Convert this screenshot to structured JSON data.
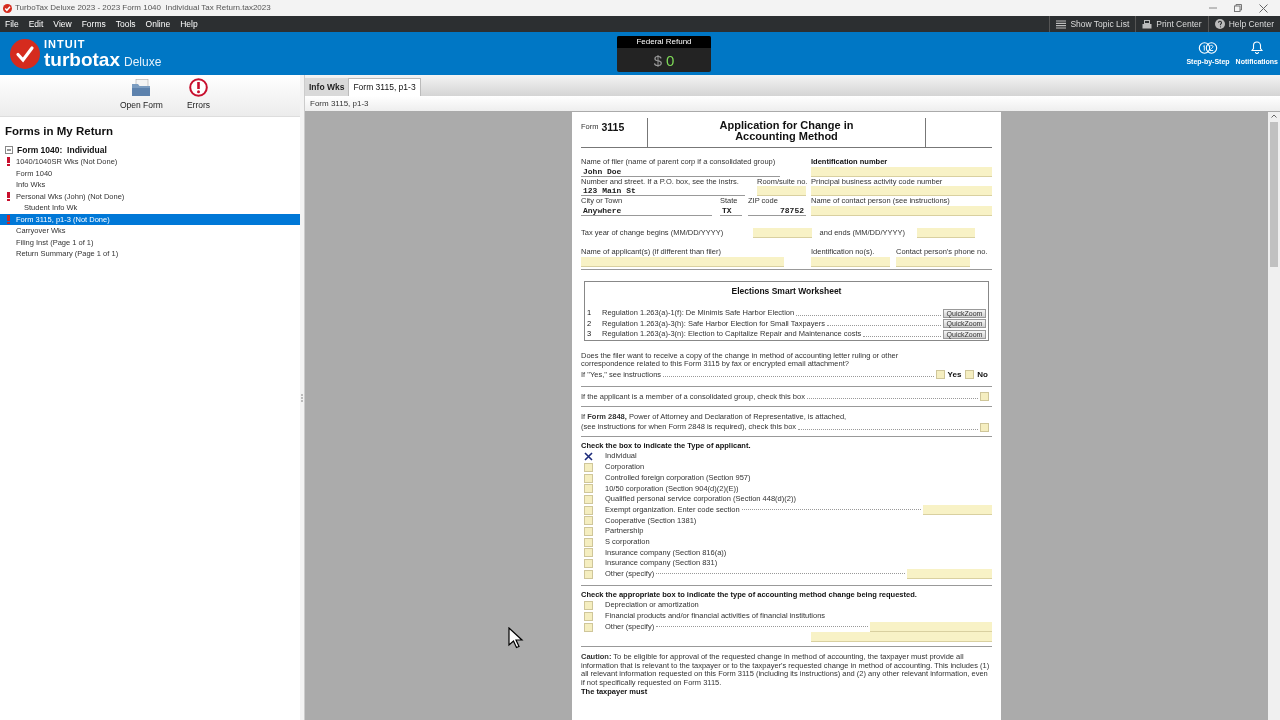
{
  "window": {
    "title": "TurboTax Deluxe 2023 - 2023 Form 1040  Individual Tax Return.tax2023"
  },
  "menu": [
    "File",
    "Edit",
    "View",
    "Forms",
    "Tools",
    "Online",
    "Help"
  ],
  "menu_links": [
    {
      "label": "Show Topic List",
      "kind": "list"
    },
    {
      "label": "Print Center",
      "kind": "printer"
    },
    {
      "label": "Help Center",
      "kind": "help"
    }
  ],
  "brand": {
    "company": "INTUIT",
    "product": "turbotax",
    "edition": "Deluxe"
  },
  "refund": {
    "label": "Federal Refund",
    "currency": "$",
    "amount": "0"
  },
  "header_buttons": [
    {
      "label": "Step-by-Step",
      "kind": "steps"
    },
    {
      "label": "Notifications",
      "kind": "bell"
    }
  ],
  "toolbar": [
    {
      "label": "Open Form",
      "kind": "folder"
    },
    {
      "label": "Errors",
      "kind": "error"
    }
  ],
  "forms_panel": {
    "title": "Forms in My Return",
    "tree": [
      {
        "label": "Form 1040:  Individual",
        "expanded": true,
        "children": [
          {
            "label": "1040/1040SR Wks (Not Done)",
            "error": true,
            "selected": false
          },
          {
            "label": "Form 1040",
            "error": false,
            "selected": false
          },
          {
            "label": "Info Wks",
            "error": false,
            "selected": false
          },
          {
            "label": "Personal Wks (John) (Not Done)",
            "error": true,
            "selected": false,
            "children": [
              {
                "label": "Student Info Wk",
                "error": false,
                "selected": false
              }
            ]
          },
          {
            "label": "Form 3115, p1-3 (Not Done)",
            "error": true,
            "selected": true
          },
          {
            "label": "Carryover Wks",
            "error": false,
            "selected": false
          },
          {
            "label": "Filing Inst (Page 1 of 1)",
            "error": false,
            "selected": false
          },
          {
            "label": "Return Summary (Page 1 of 1)",
            "error": false,
            "selected": false
          }
        ]
      }
    ]
  },
  "tabs": [
    {
      "label": "Info Wks",
      "selected": false
    },
    {
      "label": "Form 3115, p1-3",
      "selected": true
    }
  ],
  "breadcrumb": "Form 3115, p1-3",
  "form": {
    "prefix": "Form",
    "number": "3115",
    "title": "Application for Change in Accounting Method",
    "filer": {
      "label": "Name of filer (name of parent corp if a consolidated group)",
      "value": "John Doe"
    },
    "id_number": {
      "label": "Identification number"
    },
    "street": {
      "label": "Number and street. If a P.O. box, see the instrs.",
      "value": "123 Main St"
    },
    "room": {
      "label": "Room/suite no."
    },
    "activity_code": {
      "label": "Principal business activity code number"
    },
    "city": {
      "label": "City or Town",
      "value": "Anywhere"
    },
    "state": {
      "label": "State",
      "value": "TX"
    },
    "zip": {
      "label": "ZIP code",
      "value": "78752"
    },
    "contact": {
      "label": "Name of contact person (see instructions)"
    },
    "year_begins": {
      "label": "Tax year of change begins (MM/DD/YYYY)"
    },
    "year_ends": {
      "label": "and ends (MM/DD/YYYY)"
    },
    "applicant": {
      "label": "Name of applicant(s) (if different than filer)"
    },
    "id_nos": {
      "label": "Identification no(s)."
    },
    "phone": {
      "label": "Contact person's phone no."
    },
    "worksheet": {
      "title": "Elections Smart Worksheet",
      "lines": [
        {
          "number": "1",
          "text": "Regulation 1.263(a)-1(f): De Minimis Safe Harbor Election",
          "button": "QuickZoom"
        },
        {
          "number": "2",
          "text": "Regulation 1.263(a)-3(h): Safe Harbor Election for Small Taxpayers",
          "button": "QuickZoom"
        },
        {
          "number": "3",
          "text": "Regulation 1.263(a)-3(n): Election to Capitalize Repair and Maintenance costs",
          "button": "QuickZoom"
        }
      ]
    },
    "copy_question": {
      "text": "Does the filer want to receive a copy of the change in method of accounting letter ruling or other correspondence related to this Form 3115 by fax or encrypted email attachment?",
      "hint": "If \"Yes,\" see instructions",
      "options": [
        {
          "label": "Yes",
          "checked": false
        },
        {
          "label": "No",
          "checked": false
        }
      ]
    },
    "consolidated": {
      "text": "If the applicant is a member of a consolidated group, check this box",
      "checked": false
    },
    "form2848": {
      "text": "If **Form 2848,** Power of Attorney and Declaration of Representative, is attached,",
      "hint": "(see instructions for when Form 2848 is required), check this box",
      "checked": false
    },
    "applicant_type": {
      "heading": "Check the box to indicate the Type of applicant.",
      "options": [
        {
          "label": "Individual",
          "checked": true,
          "kind": "plain"
        },
        {
          "label": "Corporation",
          "checked": false,
          "kind": "plain"
        },
        {
          "label": "Controlled foreign corporation (Section 957)",
          "checked": false,
          "kind": "plain"
        },
        {
          "label": "10/50 corporation (Section 904(d)(2)(E))",
          "checked": false,
          "kind": "plain"
        },
        {
          "label": "Qualified personal service corporation (Section 448(d)(2))",
          "checked": false,
          "kind": "plain"
        },
        {
          "label": "Exempt organization. Enter code section",
          "checked": false,
          "kind": "field"
        },
        {
          "label": "Cooperative (Section 1381)",
          "checked": false,
          "kind": "plain"
        },
        {
          "label": "Partnership",
          "checked": false,
          "kind": "plain"
        },
        {
          "label": "S corporation",
          "checked": false,
          "kind": "plain"
        },
        {
          "label": "Insurance company (Section 816(a))",
          "checked": false,
          "kind": "plain"
        },
        {
          "label": "Insurance company (Section 831)",
          "checked": false,
          "kind": "plain"
        },
        {
          "label": "Other (specify)",
          "checked": false,
          "kind": "wide_field"
        }
      ]
    },
    "change_type": {
      "heading": "Check the appropriate box to indicate the type of accounting method change being requested.",
      "options": [
        {
          "label": "Depreciation or amortization",
          "checked": false,
          "kind": "plain"
        },
        {
          "label": "Financial products and/or financial activities of financial institutions",
          "checked": false,
          "kind": "plain"
        },
        {
          "label": "Other (specify)",
          "checked": false,
          "kind": "two_fields"
        }
      ]
    },
    "caution": "**Caution:** To be eligible for approval of the requested change in method of accounting, the taxpayer must provide all information that is relevant to the taxpayer or to the taxpayer's requested change in method of accounting. This includes (1) all relevant information requested on this Form 3115 (including its instructions) and (2) any other relevant information, even if not specifically requested on Form 3115.",
    "closing": "The taxpayer must"
  }
}
